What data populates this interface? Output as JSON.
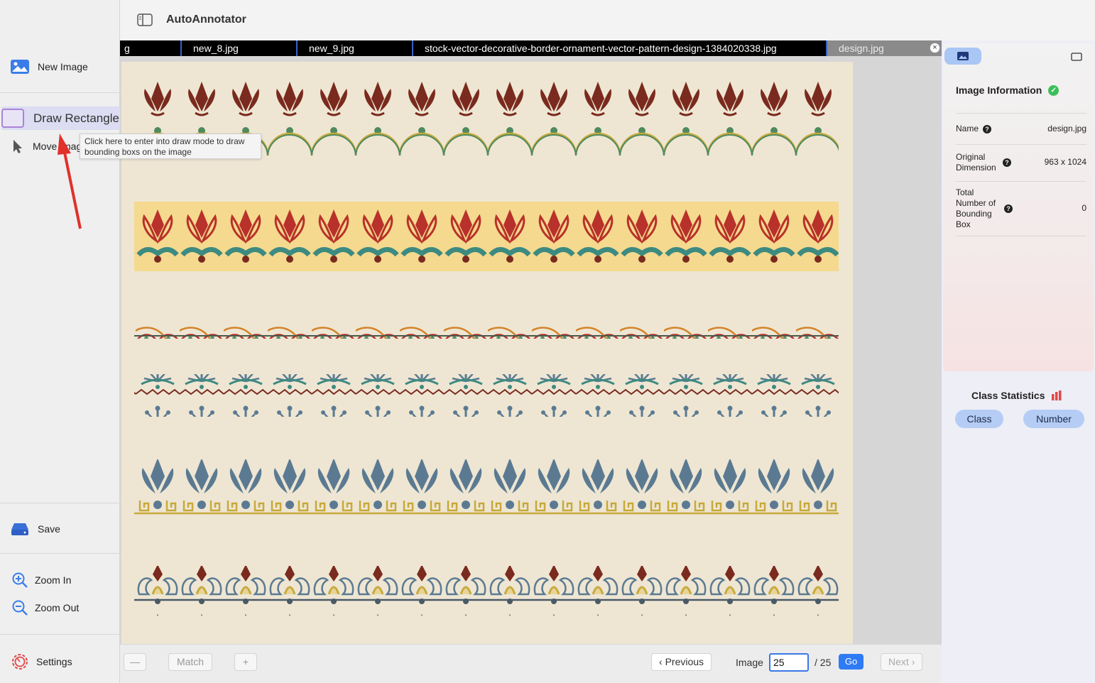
{
  "app": {
    "title": "AutoAnnotator"
  },
  "sidebar": {
    "new_image": "New Image",
    "draw_rectangle": "Draw Rectangle",
    "move_image": "Move Image",
    "save": "Save",
    "zoom_in": "Zoom In",
    "zoom_out": "Zoom Out",
    "settings": "Settings"
  },
  "tooltip": {
    "text": "Click here to enter into draw mode to draw bounding boxs on the image"
  },
  "tabs": [
    {
      "label": "g"
    },
    {
      "label": "new_8.jpg"
    },
    {
      "label": "new_9.jpg"
    },
    {
      "label": "stock-vector-decorative-border-ornament-vector-pattern-design-1384020338.jpg"
    },
    {
      "label": "design.jpg",
      "active": true
    }
  ],
  "bottombar": {
    "zoom_out_symbol": "—",
    "match_label": "Match",
    "zoom_in_symbol": "+",
    "previous_label": "Previous",
    "image_label": "Image",
    "current_image": "25",
    "total_label": "/ 25",
    "go_label": "Go",
    "next_label": "Next"
  },
  "image_info": {
    "title": "Image Information",
    "name_label": "Name",
    "name_value": "design.jpg",
    "dimension_label": "Original Dimension",
    "dimension_value": "963 x 1024",
    "bbox_label": "Total Number of Bounding Box",
    "bbox_value": "0"
  },
  "class_stats": {
    "title": "Class Statistics",
    "class_label": "Class",
    "number_label": "Number"
  },
  "colors": {
    "accent": "#2f7bf5",
    "pill": "#b5cdf5",
    "draw_border": "#a884d8",
    "ornament_red": "#7a2a1e",
    "ornament_green": "#4f8a5e",
    "ornament_blue": "#5b7a92",
    "ornament_gold": "#c8a93a"
  }
}
